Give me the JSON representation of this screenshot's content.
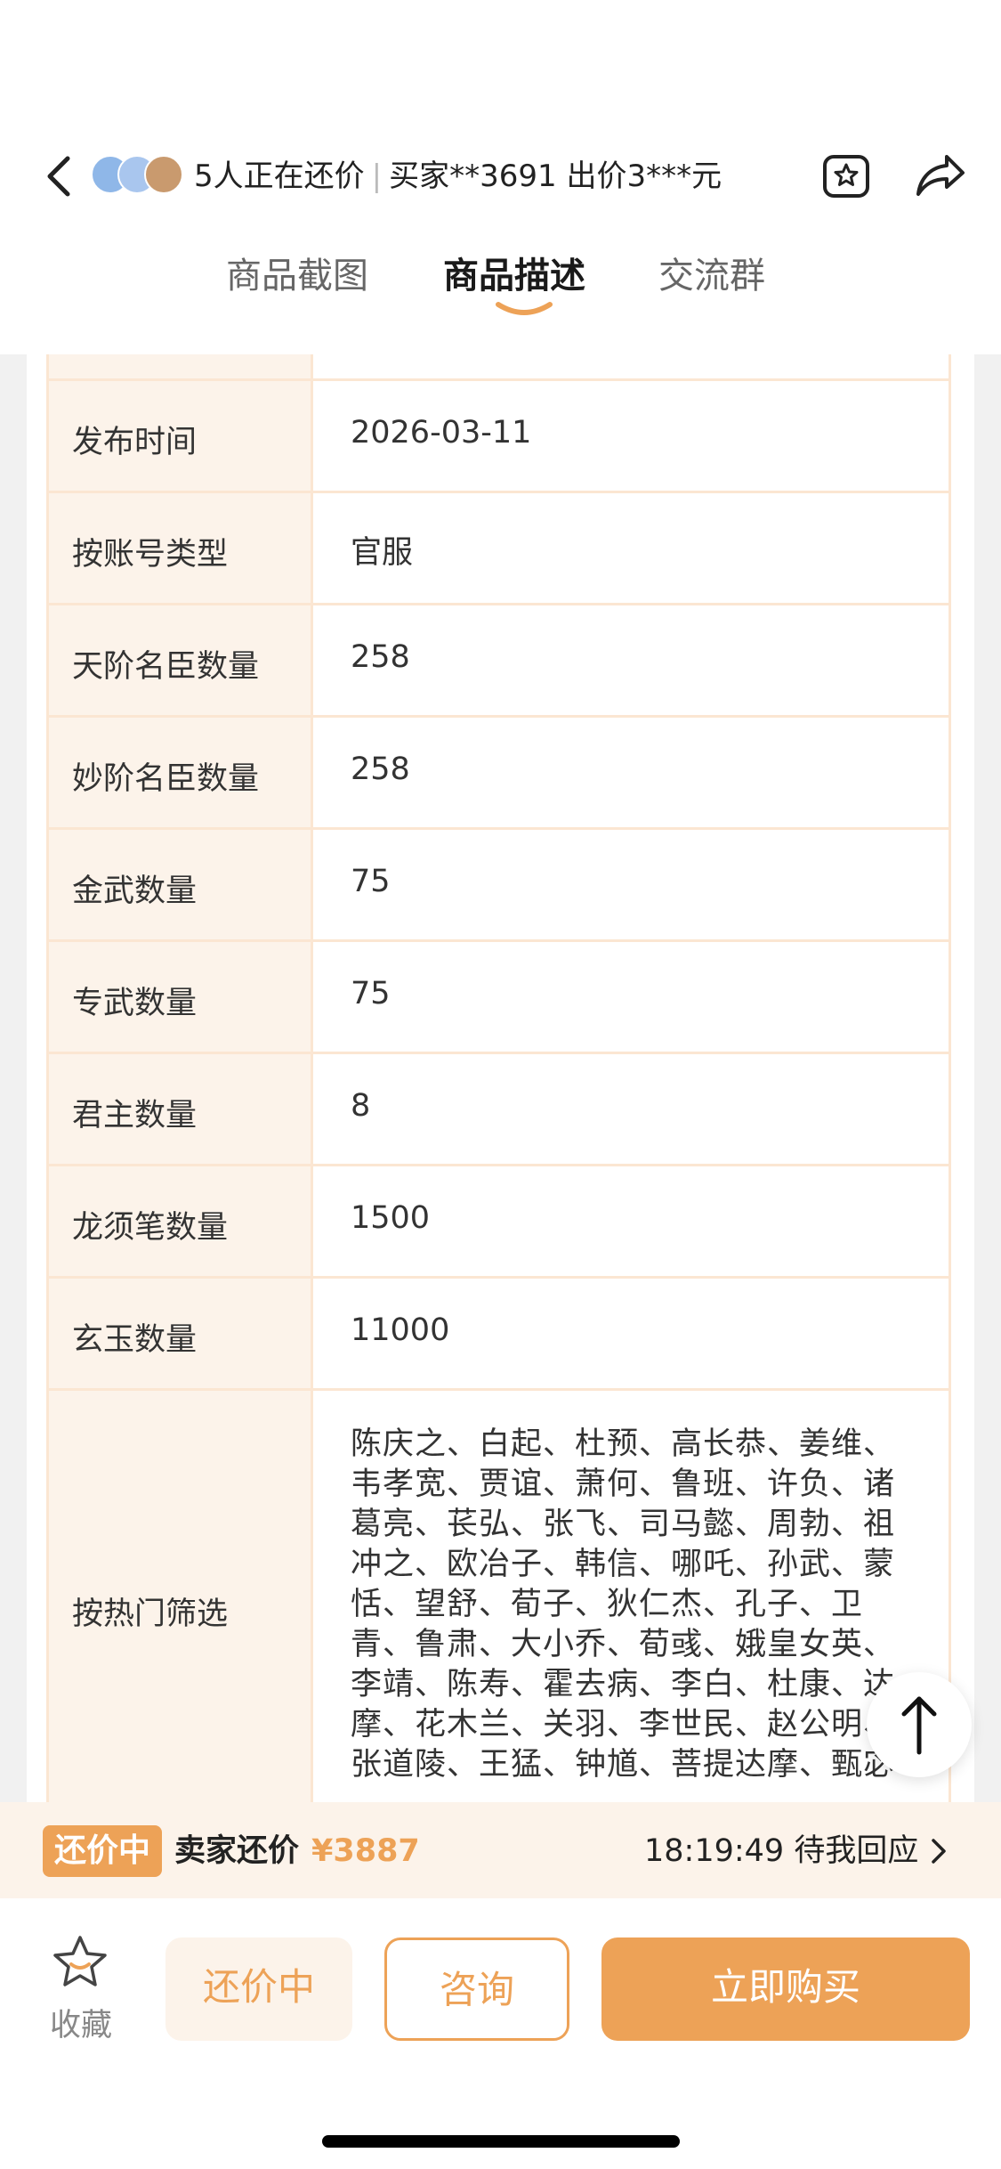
{
  "header": {
    "bargain_count_text": "5人正在还价",
    "offer_text": "买家**3691 出价3***元"
  },
  "tabs": [
    {
      "label": "商品截图"
    },
    {
      "label": "商品描述"
    },
    {
      "label": "交流群"
    }
  ],
  "table": {
    "rows": [
      {
        "label": "",
        "value": ""
      },
      {
        "label": "发布时间",
        "value": "2026-03-11"
      },
      {
        "label": "按账号类型",
        "value": "官服"
      },
      {
        "label": "天阶名臣数量",
        "value": "258"
      },
      {
        "label": "妙阶名臣数量",
        "value": "258"
      },
      {
        "label": "金武数量",
        "value": "75"
      },
      {
        "label": "专武数量",
        "value": "75"
      },
      {
        "label": "君主数量",
        "value": "8"
      },
      {
        "label": "龙须笔数量",
        "value": "1500"
      },
      {
        "label": "玄玉数量",
        "value": "11000"
      },
      {
        "label": "按热门筛选",
        "value": "陈庆之、白起、杜预、高长恭、姜维、韦孝宽、贾谊、萧何、鲁班、许负、诸葛亮、苌弘、张飞、司马懿、周勃、祖冲之、欧冶子、韩信、哪吒、孙武、蒙恬、望舒、荀子、狄仁杰、孔子、卫青、鲁肃、大小乔、荀彧、娥皇女英、李靖、陈寿、霍去病、李白、杜康、达摩、花木兰、关羽、李世民、赵公明、张道陵、王猛、钟馗、菩提达摩、甄宓"
      }
    ]
  },
  "status_bar": {
    "badge": "还价中",
    "text": "卖家还价",
    "price": "¥3887",
    "timer": "18:19:49 待我回应"
  },
  "bottom": {
    "favorite_label": "收藏",
    "bargain_button": "还价中",
    "consult_button": "咨询",
    "buy_button": "立即购买"
  },
  "colors": {
    "accent": "#eda257",
    "cell_bg": "#fcf3ea",
    "border": "#fbe6d2"
  }
}
